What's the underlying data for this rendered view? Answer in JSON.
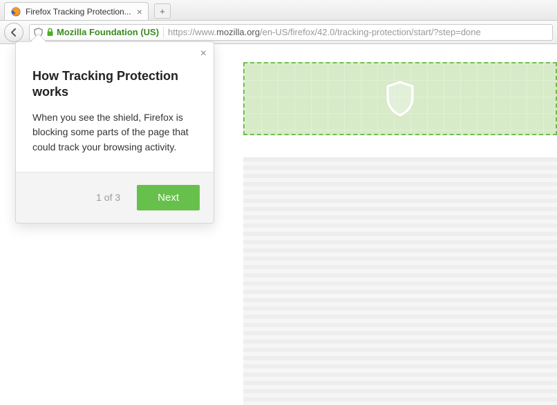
{
  "tab": {
    "title": "Firefox Tracking Protection...",
    "close_glyph": "×"
  },
  "newtab_glyph": "+",
  "urlbar": {
    "identity": "Mozilla Foundation (US)",
    "url_prefix": "https://www.",
    "url_host": "mozilla.org",
    "url_path": "/en-US/firefox/42.0/tracking-protection/start/?step=done"
  },
  "panel": {
    "title": "How Tracking Protection works",
    "body": "When you see the shield, Firefox is blocking some parts of the page that could track your browsing activity.",
    "step": "1 of 3",
    "next": "Next",
    "close_glyph": "×"
  }
}
